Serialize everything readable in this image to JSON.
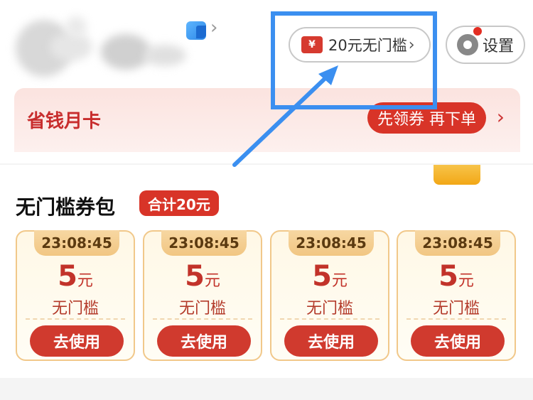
{
  "header": {
    "coupon_pill": {
      "yen": "¥",
      "text": "20元无门槛",
      "chevron": "›"
    },
    "settings_label": "设置",
    "chevron": "›"
  },
  "monthly_card": {
    "title": "省钱月卡",
    "cta": "先领券 再下单",
    "chevron": "›"
  },
  "coupon_pack": {
    "title": "无门槛券包",
    "total_badge": "合计20元",
    "coupons": [
      {
        "timer": "23:08:45",
        "amount": "5",
        "unit": "元",
        "desc": "无门槛",
        "button": "去使用"
      },
      {
        "timer": "23:08:45",
        "amount": "5",
        "unit": "元",
        "desc": "无门槛",
        "button": "去使用"
      },
      {
        "timer": "23:08:45",
        "amount": "5",
        "unit": "元",
        "desc": "无门槛",
        "button": "去使用"
      },
      {
        "timer": "23:08:45",
        "amount": "5",
        "unit": "元",
        "desc": "无门槛",
        "button": "去使用"
      }
    ]
  },
  "colors": {
    "brand_red": "#d83428",
    "highlight_blue": "#3b8ff0",
    "coupon_border": "#f1c88a"
  }
}
